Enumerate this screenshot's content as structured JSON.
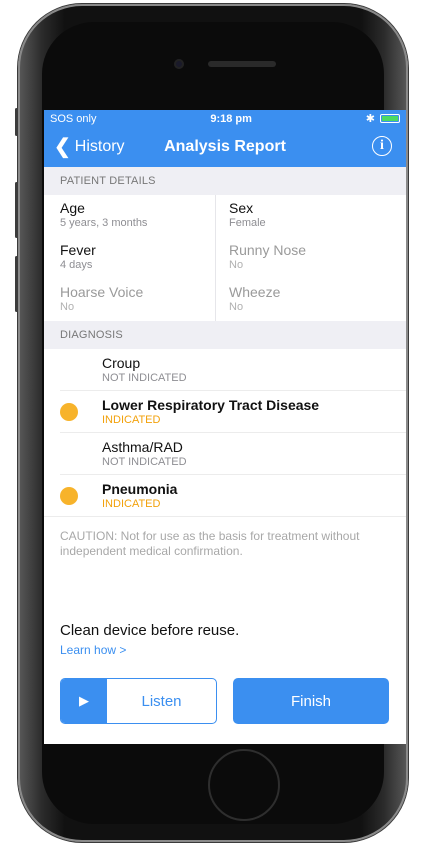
{
  "status_bar": {
    "carrier": "SOS only",
    "time": "9:18 pm",
    "bluetooth": "✱"
  },
  "nav": {
    "back_label": "History",
    "title": "Analysis Report",
    "info_glyph": "i"
  },
  "patient_details": {
    "header": "PATIENT DETAILS",
    "rows": [
      {
        "left": {
          "label": "Age",
          "value": "5 years, 3 months"
        },
        "right": {
          "label": "Sex",
          "value": "Female"
        }
      },
      {
        "left": {
          "label": "Fever",
          "value": "4 days"
        },
        "right": {
          "label": "Runny Nose",
          "value": "No"
        }
      },
      {
        "left": {
          "label": "Hoarse Voice",
          "value": "No"
        },
        "right": {
          "label": "Wheeze",
          "value": "No"
        }
      }
    ]
  },
  "diagnosis": {
    "header": "DIAGNOSIS",
    "items": [
      {
        "name": "Croup",
        "status": "NOT INDICATED"
      },
      {
        "name": "Lower Respiratory Tract Disease",
        "status": "INDICATED"
      },
      {
        "name": "Asthma/RAD",
        "status": "NOT INDICATED"
      },
      {
        "name": "Pneumonia",
        "status": "INDICATED"
      }
    ]
  },
  "caution": "CAUTION: Not for use as the basis for treatment without independent medical confirmation.",
  "clean": {
    "text": "Clean device before reuse.",
    "link": "Learn how >"
  },
  "buttons": {
    "play_glyph": "▶",
    "listen": "Listen",
    "finish": "Finish"
  },
  "colors": {
    "accent": "#3b8ff0",
    "indicated": "#f7b32b"
  },
  "icons": {
    "back": "chevron-left-icon",
    "info": "info-icon",
    "play": "play-icon",
    "indicator": "indicator-dot-icon"
  }
}
